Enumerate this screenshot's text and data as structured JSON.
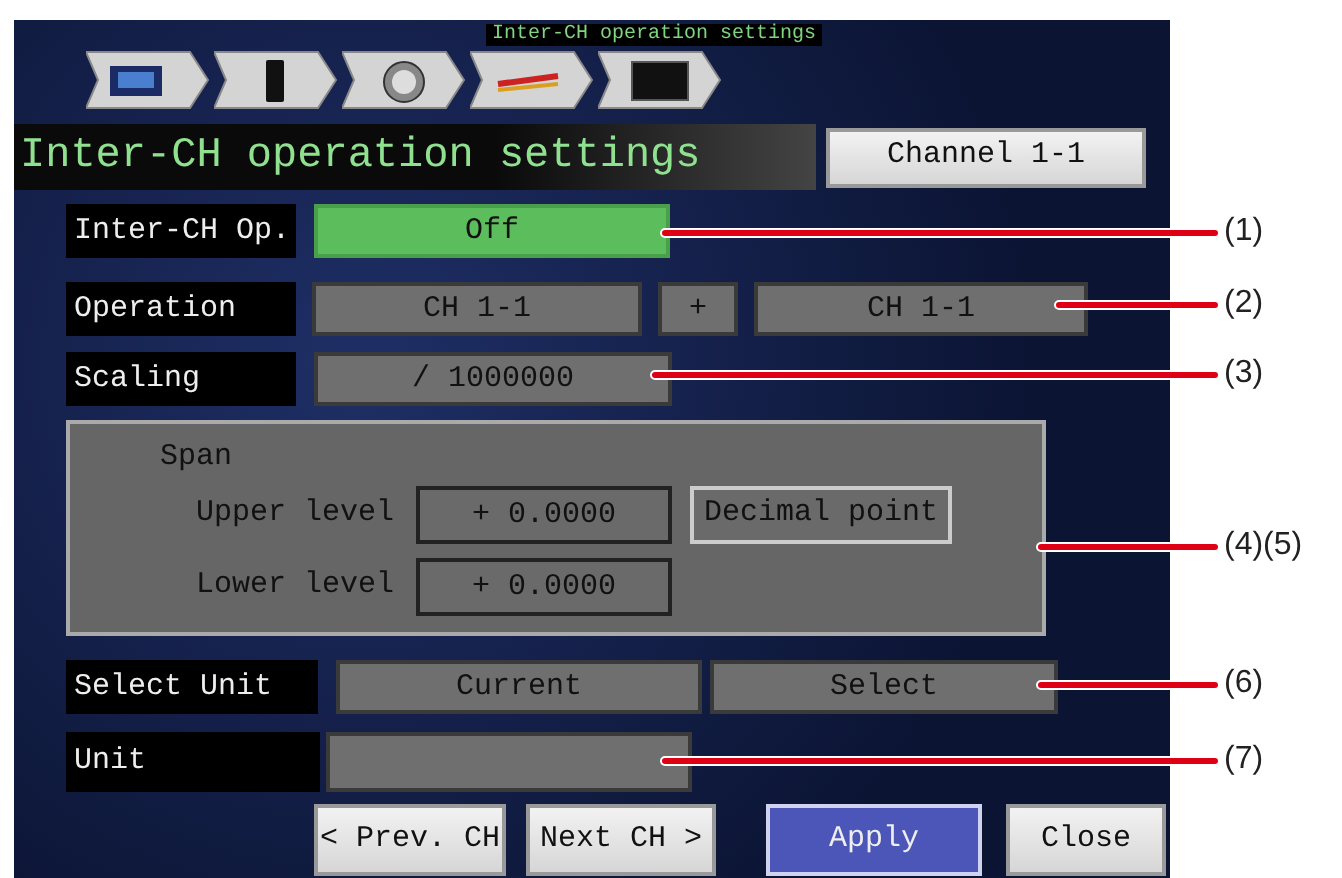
{
  "screen_caption": "Inter-CH operation settings",
  "header": {
    "title": "Inter-CH operation settings",
    "channel_button": "Channel 1-1"
  },
  "inter_ch_op": {
    "label": "Inter-CH Op.",
    "value": "Off"
  },
  "operation": {
    "label": "Operation",
    "operand_1": "CH 1-1",
    "operator": "+",
    "operand_2": "CH 1-1"
  },
  "scaling": {
    "label": "Scaling",
    "value": "/ 1000000"
  },
  "span": {
    "title": "Span",
    "upper_label": "Upper level",
    "upper_value": "+ 0.0000",
    "decimal_button": "Decimal point",
    "lower_label": "Lower level",
    "lower_value": "+ 0.0000"
  },
  "select_unit": {
    "label": "Select Unit",
    "current": "Current",
    "select": "Select"
  },
  "unit": {
    "label": "Unit"
  },
  "buttons": [
    {
      "label": "< Prev. CH",
      "kind": "normal"
    },
    {
      "label": "Next CH >",
      "kind": "normal"
    },
    {
      "label": "Apply",
      "kind": "primary"
    },
    {
      "label": "Close",
      "kind": "normal"
    }
  ],
  "callouts": [
    {
      "label": "(1)"
    },
    {
      "label": "(2)"
    },
    {
      "label": "(3)"
    },
    {
      "label": "(4)(5)"
    },
    {
      "label": "(6)"
    },
    {
      "label": "(7)"
    }
  ]
}
